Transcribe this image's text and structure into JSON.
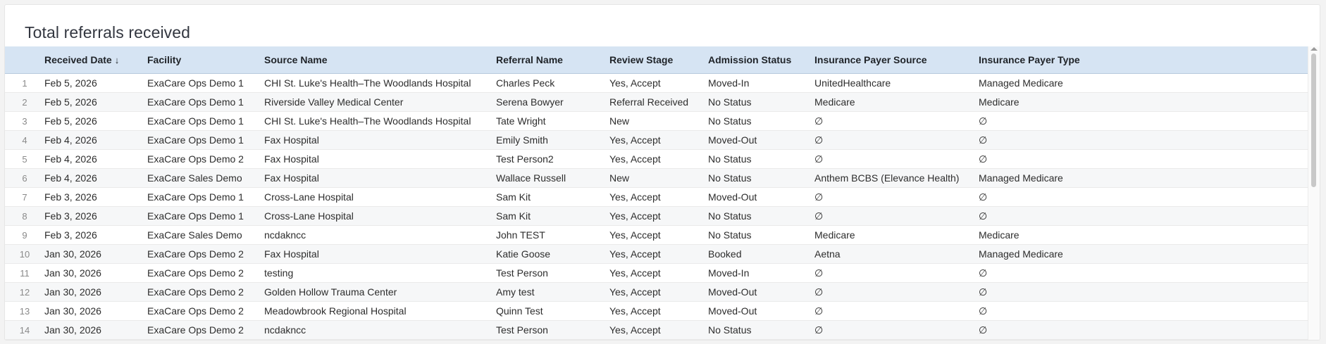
{
  "widget": {
    "title": "Total referrals received"
  },
  "table": {
    "sort_indicator": "↓",
    "columns": [
      "Received Date",
      "Facility",
      "Source Name",
      "Referral Name",
      "Review Stage",
      "Admission Status",
      "Insurance Payer Source",
      "Insurance Payer Type"
    ],
    "rows": [
      {
        "n": "1",
        "date": "Feb 5, 2026",
        "facility": "ExaCare Ops Demo 1",
        "source": "CHI St. Luke's Health–The Woodlands Hospital",
        "referral": "Charles Peck",
        "stage": "Yes, Accept",
        "admission": "Moved-In",
        "payer_source": "UnitedHealthcare",
        "payer_type": "Managed Medicare"
      },
      {
        "n": "2",
        "date": "Feb 5, 2026",
        "facility": "ExaCare Ops Demo 1",
        "source": "Riverside Valley Medical Center",
        "referral": "Serena Bowyer",
        "stage": "Referral Received",
        "admission": "No Status",
        "payer_source": "Medicare",
        "payer_type": "Medicare"
      },
      {
        "n": "3",
        "date": "Feb 5, 2026",
        "facility": "ExaCare Ops Demo 1",
        "source": "CHI St. Luke's Health–The Woodlands Hospital",
        "referral": "Tate Wright",
        "stage": "New",
        "admission": "No Status",
        "payer_source": "∅",
        "payer_type": "∅"
      },
      {
        "n": "4",
        "date": "Feb 4, 2026",
        "facility": "ExaCare Ops Demo 1",
        "source": "Fax Hospital",
        "referral": "Emily Smith",
        "stage": "Yes, Accept",
        "admission": "Moved-Out",
        "payer_source": "∅",
        "payer_type": "∅"
      },
      {
        "n": "5",
        "date": "Feb 4, 2026",
        "facility": "ExaCare Ops Demo 2",
        "source": "Fax Hospital",
        "referral": "Test Person2",
        "stage": "Yes, Accept",
        "admission": "No Status",
        "payer_source": "∅",
        "payer_type": "∅"
      },
      {
        "n": "6",
        "date": "Feb 4, 2026",
        "facility": "ExaCare Sales Demo",
        "source": "Fax Hospital",
        "referral": "Wallace Russell",
        "stage": "New",
        "admission": "No Status",
        "payer_source": "Anthem BCBS (Elevance Health)",
        "payer_type": "Managed Medicare"
      },
      {
        "n": "7",
        "date": "Feb 3, 2026",
        "facility": "ExaCare Ops Demo 1",
        "source": "Cross-Lane Hospital",
        "referral": "Sam Kit",
        "stage": "Yes, Accept",
        "admission": "Moved-Out",
        "payer_source": "∅",
        "payer_type": "∅"
      },
      {
        "n": "8",
        "date": "Feb 3, 2026",
        "facility": "ExaCare Ops Demo 1",
        "source": "Cross-Lane Hospital",
        "referral": "Sam Kit",
        "stage": "Yes, Accept",
        "admission": "No Status",
        "payer_source": "∅",
        "payer_type": "∅"
      },
      {
        "n": "9",
        "date": "Feb 3, 2026",
        "facility": "ExaCare Sales Demo",
        "source": "ncdakncc",
        "referral": "John TEST",
        "stage": "Yes, Accept",
        "admission": "No Status",
        "payer_source": "Medicare",
        "payer_type": "Medicare"
      },
      {
        "n": "10",
        "date": "Jan 30, 2026",
        "facility": "ExaCare Ops Demo 2",
        "source": "Fax Hospital",
        "referral": "Katie Goose",
        "stage": "Yes, Accept",
        "admission": "Booked",
        "payer_source": "Aetna",
        "payer_type": "Managed Medicare"
      },
      {
        "n": "11",
        "date": "Jan 30, 2026",
        "facility": "ExaCare Ops Demo 2",
        "source": "testing",
        "referral": "Test Person",
        "stage": "Yes, Accept",
        "admission": "Moved-In",
        "payer_source": "∅",
        "payer_type": "∅"
      },
      {
        "n": "12",
        "date": "Jan 30, 2026",
        "facility": "ExaCare Ops Demo 2",
        "source": "Golden Hollow Trauma Center",
        "referral": "Amy test",
        "stage": "Yes, Accept",
        "admission": "Moved-Out",
        "payer_source": "∅",
        "payer_type": "∅"
      },
      {
        "n": "13",
        "date": "Jan 30, 2026",
        "facility": "ExaCare Ops Demo 2",
        "source": "Meadowbrook Regional Hospital",
        "referral": "Quinn Test",
        "stage": "Yes, Accept",
        "admission": "Moved-Out",
        "payer_source": "∅",
        "payer_type": "∅"
      },
      {
        "n": "14",
        "date": "Jan 30, 2026",
        "facility": "ExaCare Ops Demo 2",
        "source": "ncdakncc",
        "referral": "Test Person",
        "stage": "Yes, Accept",
        "admission": "No Status",
        "payer_source": "∅",
        "payer_type": "∅"
      }
    ]
  }
}
